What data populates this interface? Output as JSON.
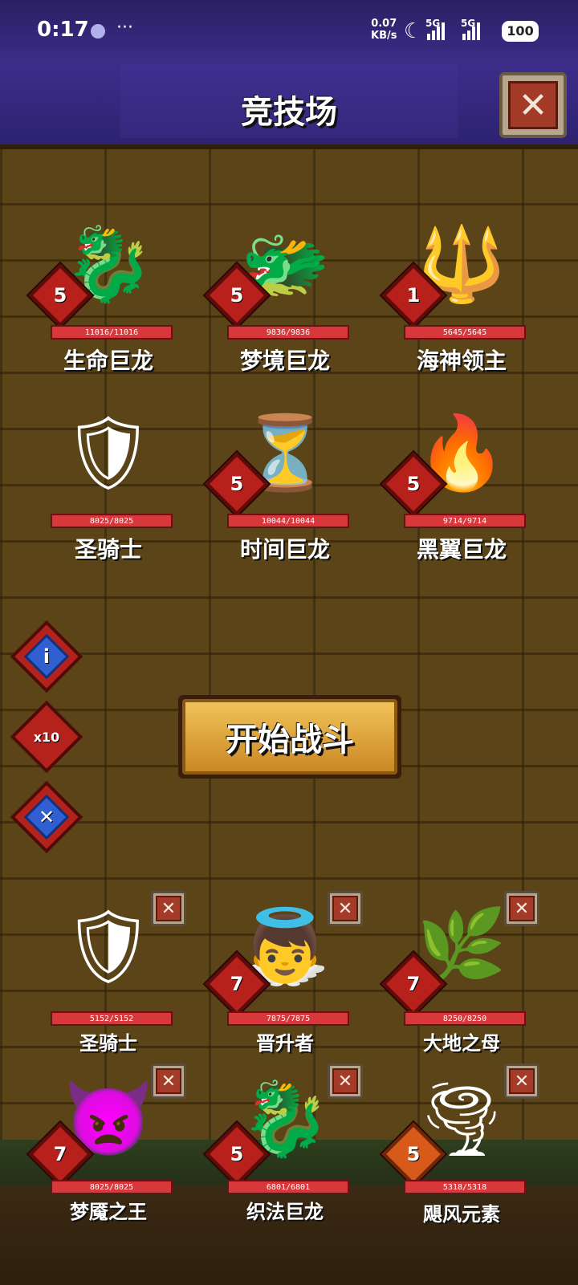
{
  "status_bar": {
    "time": "0:17",
    "dots": "···",
    "speed": "0.07",
    "speed_unit": "KB/s",
    "sim1": "5G",
    "sim2": "5G",
    "battery": "100"
  },
  "header": {
    "title": "竞技场"
  },
  "enemies": [
    {
      "name": "生命巨龙",
      "level": "5",
      "hp": "11016/11016",
      "icon": "red-dragon"
    },
    {
      "name": "梦境巨龙",
      "level": "5",
      "hp": "9836/9836",
      "icon": "green-dragon"
    },
    {
      "name": "海神领主",
      "level": "1",
      "hp": "5645/5645",
      "icon": "sea-lord"
    },
    {
      "name": "圣骑士",
      "level": "",
      "hp": "8025/8025",
      "icon": "paladin"
    },
    {
      "name": "时间巨龙",
      "level": "5",
      "hp": "10044/10044",
      "icon": "golden-dragon"
    },
    {
      "name": "黑翼巨龙",
      "level": "5",
      "hp": "9714/9714",
      "icon": "black-dragon"
    }
  ],
  "side_buttons": {
    "info": "i",
    "speed": "x10",
    "cancel": "✕"
  },
  "start_button": "开始战斗",
  "team": [
    {
      "name": "圣骑士",
      "level": "",
      "hp": "5152/5152",
      "icon": "paladin"
    },
    {
      "name": "晋升者",
      "level": "7",
      "hp": "7875/7875",
      "icon": "ascendant"
    },
    {
      "name": "大地之母",
      "level": "7",
      "hp": "8250/8250",
      "icon": "earth-mother"
    },
    {
      "name": "梦魇之王",
      "level": "7",
      "hp": "8025/8025",
      "icon": "nightmare-king"
    },
    {
      "name": "织法巨龙",
      "level": "5",
      "hp": "6801/6801",
      "icon": "blue-dragon"
    },
    {
      "name": "飓风元素",
      "level": "5",
      "hp": "5318/5318",
      "icon": "hurricane-elemental"
    }
  ],
  "colors": {
    "header": "#3d2d8a",
    "wall": "#5a4418",
    "level": "#b8201c",
    "hp": "#d8383c"
  }
}
